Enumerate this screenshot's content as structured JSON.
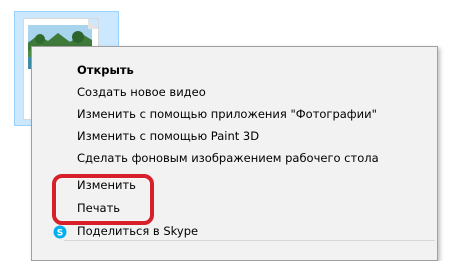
{
  "file": {
    "icon": "image-file-thumbnail"
  },
  "context_menu": {
    "items": [
      {
        "label": "Открыть",
        "bold": true
      },
      {
        "label": "Создать новое видео"
      },
      {
        "label": "Изменить с помощью приложения \"Фотографии\""
      },
      {
        "label": "Изменить с помощью Paint 3D"
      },
      {
        "label": "Сделать фоновым изображением рабочего стола"
      },
      {
        "label": "Изменить"
      },
      {
        "label": "Печать"
      },
      {
        "label": "Поделиться в Skype",
        "icon": "skype-icon"
      }
    ]
  },
  "annotation": {
    "color": "#d8202a",
    "target": "Печать"
  }
}
